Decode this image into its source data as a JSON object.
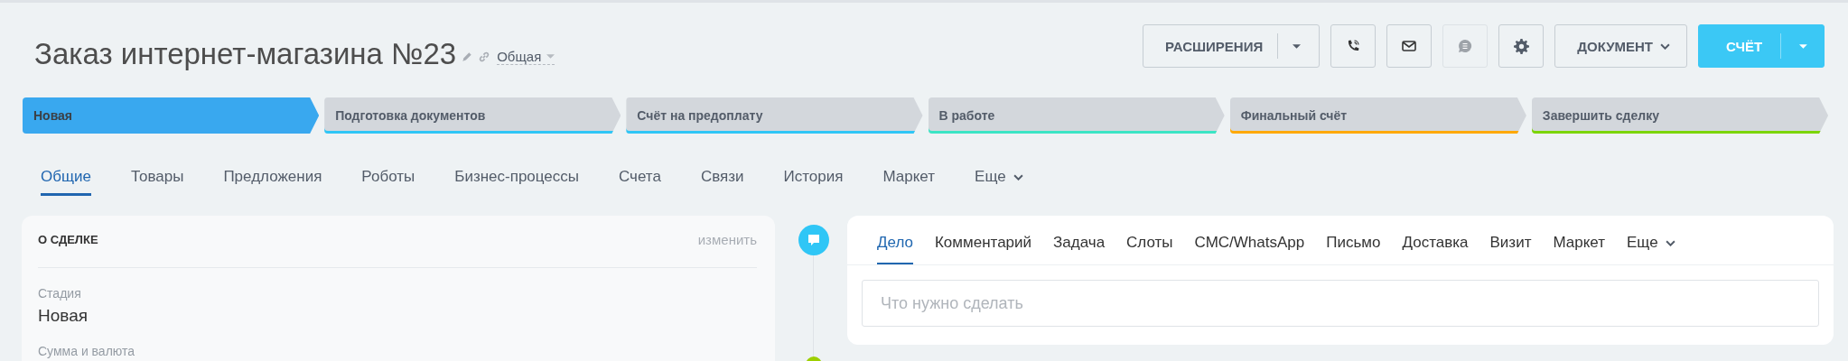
{
  "header": {
    "title": "Заказ интернет-магазина №23",
    "category": "Общая"
  },
  "toolbar": {
    "extensions": "РАСШИРЕНИЯ",
    "icon_buttons": [
      {
        "kind": "phone",
        "disabled": false
      },
      {
        "kind": "mail",
        "disabled": false
      },
      {
        "kind": "chat",
        "disabled": true
      },
      {
        "kind": "gear",
        "disabled": false
      }
    ],
    "document": "ДОКУМЕНТ",
    "primary": "СЧЁТ"
  },
  "stages": [
    {
      "label": "Новая",
      "selected": true,
      "color": "#39a8ef"
    },
    {
      "label": "Подготовка документов",
      "selected": false,
      "color": "#2fc6f6"
    },
    {
      "label": "Счёт на предоплату",
      "selected": false,
      "color": "#2fc6f6"
    },
    {
      "label": "В работе",
      "selected": false,
      "color": "#3be5c5"
    },
    {
      "label": "Финальный счёт",
      "selected": false,
      "color": "#ffa900"
    },
    {
      "label": "Завершить сделку",
      "selected": false,
      "color": "#7bd500"
    }
  ],
  "tabs": [
    {
      "label": "Общие",
      "selected": true,
      "kind": "tab"
    },
    {
      "label": "Товары",
      "selected": false,
      "kind": "tab"
    },
    {
      "label": "Предложения",
      "selected": false,
      "kind": "tab"
    },
    {
      "label": "Роботы",
      "selected": false,
      "kind": "tab"
    },
    {
      "label": "Бизнес-процессы",
      "selected": false,
      "kind": "tab"
    },
    {
      "label": "Счета",
      "selected": false,
      "kind": "tab"
    },
    {
      "label": "Связи",
      "selected": false,
      "kind": "tab"
    },
    {
      "label": "История",
      "selected": false,
      "kind": "tab"
    },
    {
      "label": "Маркет",
      "selected": false,
      "kind": "tab"
    },
    {
      "label": "Еще",
      "selected": false,
      "kind": "more"
    }
  ],
  "deal_card": {
    "title": "О СДЕЛКЕ",
    "edit": "изменить",
    "fields": [
      {
        "label": "Стадия",
        "value": "Новая"
      },
      {
        "label": "Сумма и валюта"
      }
    ]
  },
  "activity": {
    "tabs": [
      {
        "label": "Дело",
        "selected": true,
        "kind": "tab"
      },
      {
        "label": "Комментарий",
        "selected": false,
        "kind": "tab"
      },
      {
        "label": "Задача",
        "selected": false,
        "kind": "tab"
      },
      {
        "label": "Слоты",
        "selected": false,
        "kind": "tab"
      },
      {
        "label": "СМС/WhatsApp",
        "selected": false,
        "kind": "tab"
      },
      {
        "label": "Письмо",
        "selected": false,
        "kind": "tab"
      },
      {
        "label": "Доставка",
        "selected": false,
        "kind": "tab"
      },
      {
        "label": "Визит",
        "selected": false,
        "kind": "tab"
      },
      {
        "label": "Маркет",
        "selected": false,
        "kind": "tab"
      },
      {
        "label": "Еще",
        "selected": false,
        "kind": "more"
      }
    ],
    "placeholder": "Что нужно сделать"
  }
}
